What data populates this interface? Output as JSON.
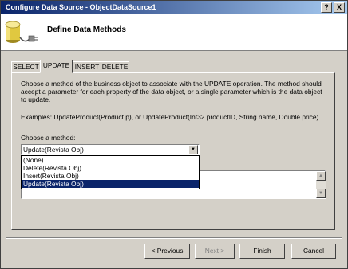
{
  "window": {
    "title": "Configure Data Source - ObjectDataSource1",
    "help_label": "?",
    "close_label": "X"
  },
  "header": {
    "title": "Define Data Methods"
  },
  "tabs": [
    {
      "label": "SELECT"
    },
    {
      "label": "UPDATE",
      "active": true
    },
    {
      "label": "INSERT"
    },
    {
      "label": "DELETE"
    }
  ],
  "panel": {
    "description": "Choose a method of the business object to associate with the UPDATE operation. The method should accept a parameter for each property of the data object, or a single parameter which is the data object to update.",
    "examples": "Examples: UpdateProduct(Product p), or UpdateProduct(Int32 productID, String name, Double price)",
    "method_label": "Choose a method:",
    "method_value": "Update(Revista Obj)",
    "method_options": [
      "(None)",
      "Delete(Revista Obj)",
      "Insert(Revista Obj)",
      "Update(Revista Obj)"
    ],
    "selected_option": "Update(Revista Obj)"
  },
  "buttons": {
    "previous": "< Previous",
    "next": "Next >",
    "finish": "Finish",
    "cancel": "Cancel"
  },
  "colors": {
    "titlebar_start": "#0a246a",
    "titlebar_end": "#a6caf0",
    "selection": "#0a246a",
    "face": "#d4d0c8"
  },
  "icons": {
    "header": "database-plug-icon",
    "combo": "chevron-down-icon"
  }
}
